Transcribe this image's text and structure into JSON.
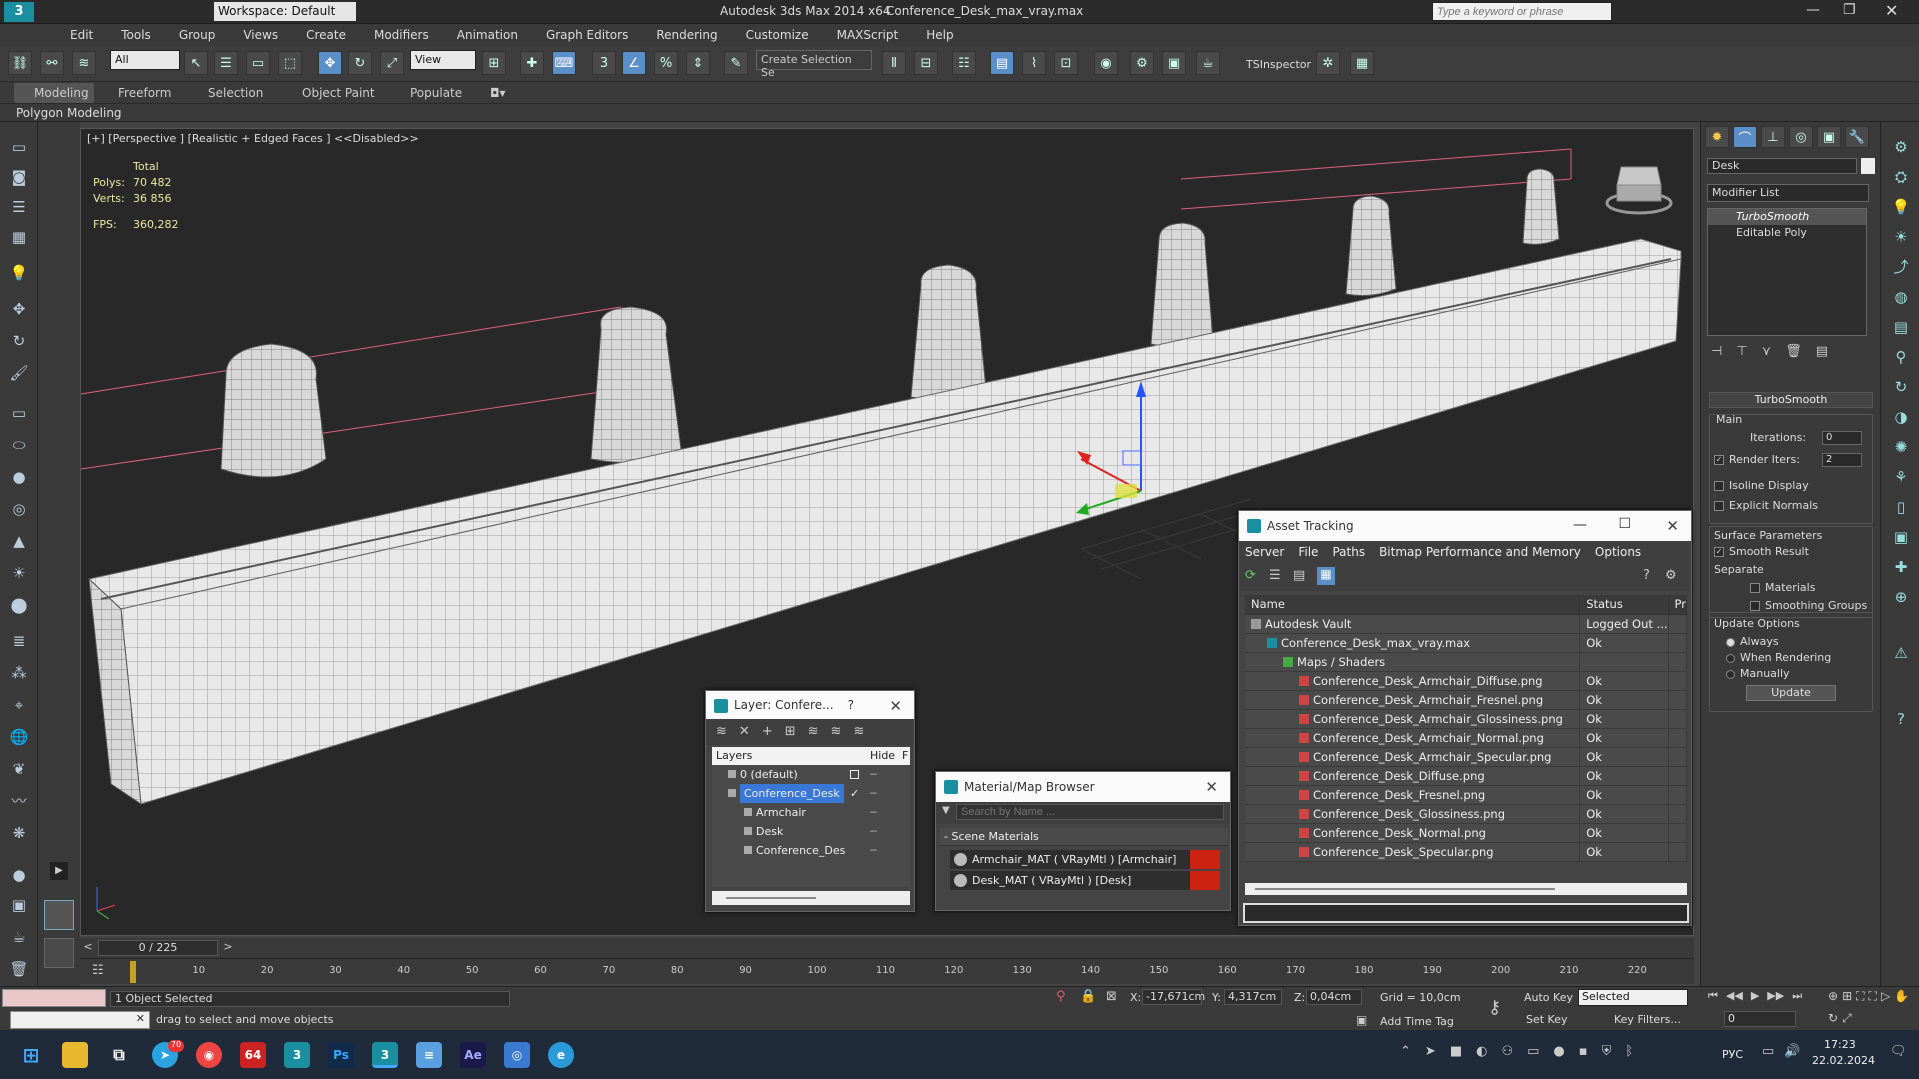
{
  "titlebar": {
    "workspace_label": "Workspace: Default",
    "app_title": "Autodesk 3ds Max  2014 x64",
    "file_title": "Conference_Desk_max_vray.max",
    "search_placeholder": "Type a keyword or phrase"
  },
  "menu": [
    "Edit",
    "Tools",
    "Group",
    "Views",
    "Create",
    "Modifiers",
    "Animation",
    "Graph Editors",
    "Rendering",
    "Customize",
    "MAXScript",
    "Help"
  ],
  "toolbar": {
    "filter_value": "All",
    "ref_coord_value": "View",
    "selection_set_placeholder": "Create Selection Se",
    "tsinspector_label": "TSInspector"
  },
  "ribbon": {
    "tabs": [
      "Modeling",
      "Freeform",
      "Selection",
      "Object Paint",
      "Populate"
    ],
    "sub_label": "Polygon Modeling"
  },
  "viewport": {
    "label": "[+] [Perspective ] [Realistic + Edged Faces ]  <<Disabled>>",
    "stats_total_label": "Total",
    "polys_label": "Polys:",
    "polys_value": "70 482",
    "verts_label": "Verts:",
    "verts_value": "36 856",
    "fps_label": "FPS:",
    "fps_value": "360,282"
  },
  "command_panel": {
    "object_name": "Desk",
    "modifier_list_label": "Modifier List",
    "stack": [
      "TurboSmooth",
      "Editable Poly"
    ],
    "rollout_title": "TurboSmooth",
    "main_label": "Main",
    "iterations_label": "Iterations:",
    "iterations_value": "0",
    "render_iters_label": "Render Iters:",
    "render_iters_value": "2",
    "isoline_label": "Isoline Display",
    "explicit_normals_label": "Explicit Normals",
    "surface_params_label": "Surface Parameters",
    "smooth_result_label": "Smooth Result",
    "separate_label": "Separate",
    "materials_label": "Materials",
    "smoothing_groups_label": "Smoothing Groups",
    "update_options_label": "Update Options",
    "always_label": "Always",
    "when_rendering_label": "When Rendering",
    "manually_label": "Manually",
    "update_button": "Update"
  },
  "asset_tracking": {
    "title": "Asset Tracking",
    "menu": [
      "Server",
      "File",
      "Paths",
      "Bitmap Performance and Memory",
      "Options"
    ],
    "col_name": "Name",
    "col_status": "Status",
    "col_extra": "Pr",
    "rows": [
      {
        "name": "Autodesk Vault",
        "status": "Logged Out ...",
        "indent": 1
      },
      {
        "name": "Conference_Desk_max_vray.max",
        "status": "Ok",
        "indent": 2
      },
      {
        "name": "Maps / Shaders",
        "status": "",
        "indent": 3
      },
      {
        "name": "Conference_Desk_Armchair_Diffuse.png",
        "status": "Ok",
        "indent": 4
      },
      {
        "name": "Conference_Desk_Armchair_Fresnel.png",
        "status": "Ok",
        "indent": 4
      },
      {
        "name": "Conference_Desk_Armchair_Glossiness.png",
        "status": "Ok",
        "indent": 4
      },
      {
        "name": "Conference_Desk_Armchair_Normal.png",
        "status": "Ok",
        "indent": 4
      },
      {
        "name": "Conference_Desk_Armchair_Specular.png",
        "status": "Ok",
        "indent": 4
      },
      {
        "name": "Conference_Desk_Diffuse.png",
        "status": "Ok",
        "indent": 4
      },
      {
        "name": "Conference_Desk_Fresnel.png",
        "status": "Ok",
        "indent": 4
      },
      {
        "name": "Conference_Desk_Glossiness.png",
        "status": "Ok",
        "indent": 4
      },
      {
        "name": "Conference_Desk_Normal.png",
        "status": "Ok",
        "indent": 4
      },
      {
        "name": "Conference_Desk_Specular.png",
        "status": "Ok",
        "indent": 4
      }
    ]
  },
  "layer_window": {
    "title": "Layer: Confere...",
    "help": "?",
    "col_layers": "Layers",
    "col_hide": "Hide",
    "col_f": "F",
    "items": [
      {
        "name": "0 (default)",
        "indent": 1,
        "selected": false
      },
      {
        "name": "Conference_Desk",
        "indent": 1,
        "selected": true
      },
      {
        "name": "Armchair",
        "indent": 2,
        "selected": false
      },
      {
        "name": "Desk",
        "indent": 2,
        "selected": false
      },
      {
        "name": "Conference_Des",
        "indent": 2,
        "selected": false
      }
    ]
  },
  "material_browser": {
    "title": "Material/Map Browser",
    "search_placeholder": "Search by Name ...",
    "group_label": "- Scene Materials",
    "items": [
      "Armchair_MAT  ( VRayMtl ) [Armchair]",
      "Desk_MAT  ( VRayMtl ) [Desk]"
    ]
  },
  "timeline": {
    "frame_label": "0 / 225",
    "ticks": [
      "10",
      "20",
      "30",
      "40",
      "50",
      "60",
      "70",
      "80",
      "90",
      "100",
      "110",
      "120",
      "130",
      "140",
      "150",
      "160",
      "170",
      "180",
      "190",
      "200",
      "210",
      "220"
    ]
  },
  "status": {
    "selected_label": "1 Object Selected",
    "prompt": "drag to select and move objects",
    "x_label": "X:",
    "x_value": "-17,671cm",
    "y_label": "Y:",
    "y_value": "4,317cm",
    "z_label": "Z:",
    "z_value": "0,04cm",
    "grid_label": "Grid = 10,0cm",
    "add_time_tag": "Add Time Tag",
    "auto_key": "Auto Key",
    "set_key": "Set Key",
    "selected_value": "Selected",
    "key_filters": "Key Filters...",
    "frame_value": "0"
  },
  "taskbar": {
    "lang": "РУС",
    "time": "17:23",
    "date": "22.02.2024",
    "badge_64": "64",
    "badge_70": "70"
  }
}
